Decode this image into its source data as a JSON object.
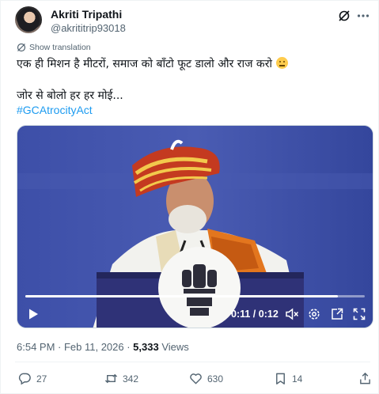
{
  "author": {
    "name": "Akriti Tripathi",
    "handle": "@akrititrip93018"
  },
  "translate_label": "Show translation",
  "tweet": {
    "line1": "एक ही मिशन है मीटरों, समाज को बाँटो फूट डालो और राज करो",
    "line2": "जोर से बोलो हर हर मोई...",
    "hashtag": "#GCAtrocityAct"
  },
  "video": {
    "time": "0:11 / 0:12",
    "progress": 0.92
  },
  "meta": {
    "timestamp": "6:54 PM · Feb 11, 2026 · ",
    "views_count": "5,333",
    "views_label": " Views"
  },
  "actions": {
    "replies": "27",
    "reposts": "342",
    "likes": "630",
    "bookmarks": "14"
  },
  "colors": {
    "accent": "#1d9bf0",
    "text": "#0f1419",
    "secondary": "#536471"
  }
}
